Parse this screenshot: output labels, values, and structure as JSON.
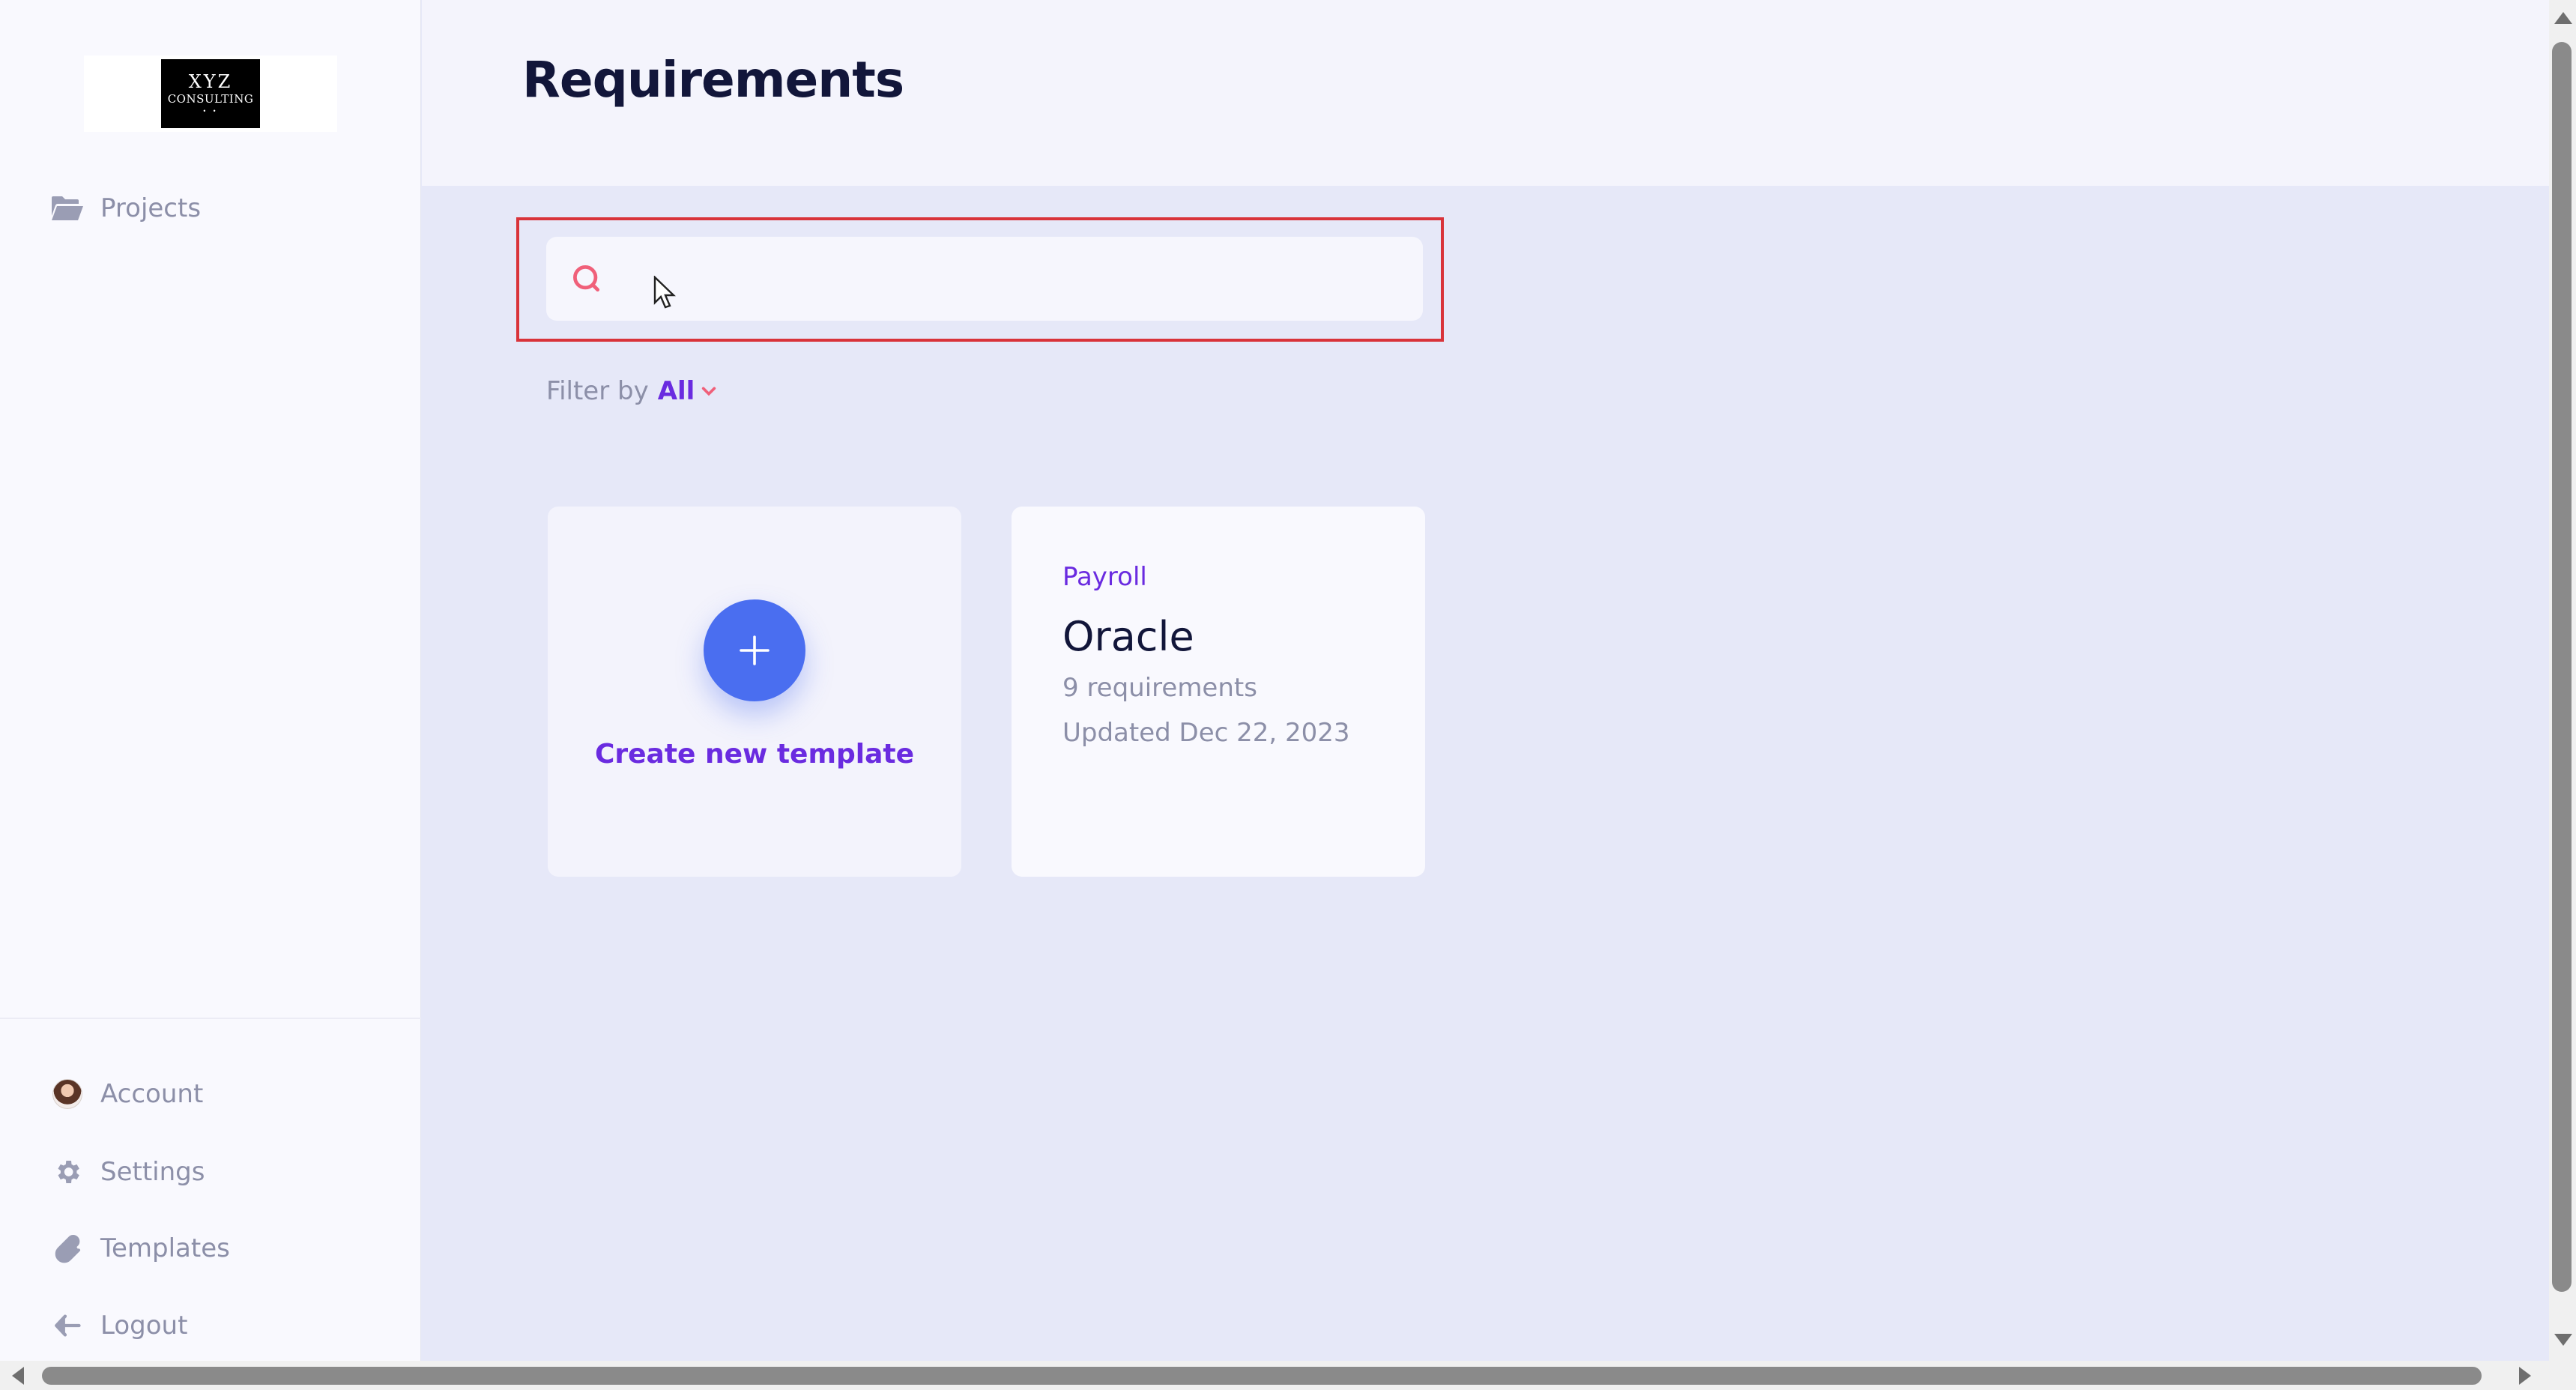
{
  "brand": {
    "logo_line1": "XYZ",
    "logo_line2": "CONSULTING",
    "logo_line3": "• •"
  },
  "sidebar": {
    "top_items": [
      {
        "label": "Projects",
        "icon": "folder-open-icon"
      }
    ],
    "bottom_items": [
      {
        "label": "Account",
        "icon": "avatar"
      },
      {
        "label": "Settings",
        "icon": "gear-icon"
      },
      {
        "label": "Templates",
        "icon": "paperclip-icon"
      },
      {
        "label": "Logout",
        "icon": "arrow-left-icon"
      }
    ]
  },
  "header": {
    "title": "Requirements"
  },
  "search": {
    "value": "",
    "placeholder": ""
  },
  "filter": {
    "label": "Filter by",
    "value": "All"
  },
  "cards": {
    "new_template_label": "Create new template",
    "templates": [
      {
        "category": "Payroll",
        "name": "Oracle",
        "count": "9 requirements",
        "updated": "Updated Dec 22, 2023"
      }
    ]
  },
  "colors": {
    "accent": "#6a2be0",
    "primary_button": "#4a6ef0",
    "highlight_border": "#d9333a",
    "search_icon": "#f0607a",
    "chevron": "#f0607a"
  }
}
